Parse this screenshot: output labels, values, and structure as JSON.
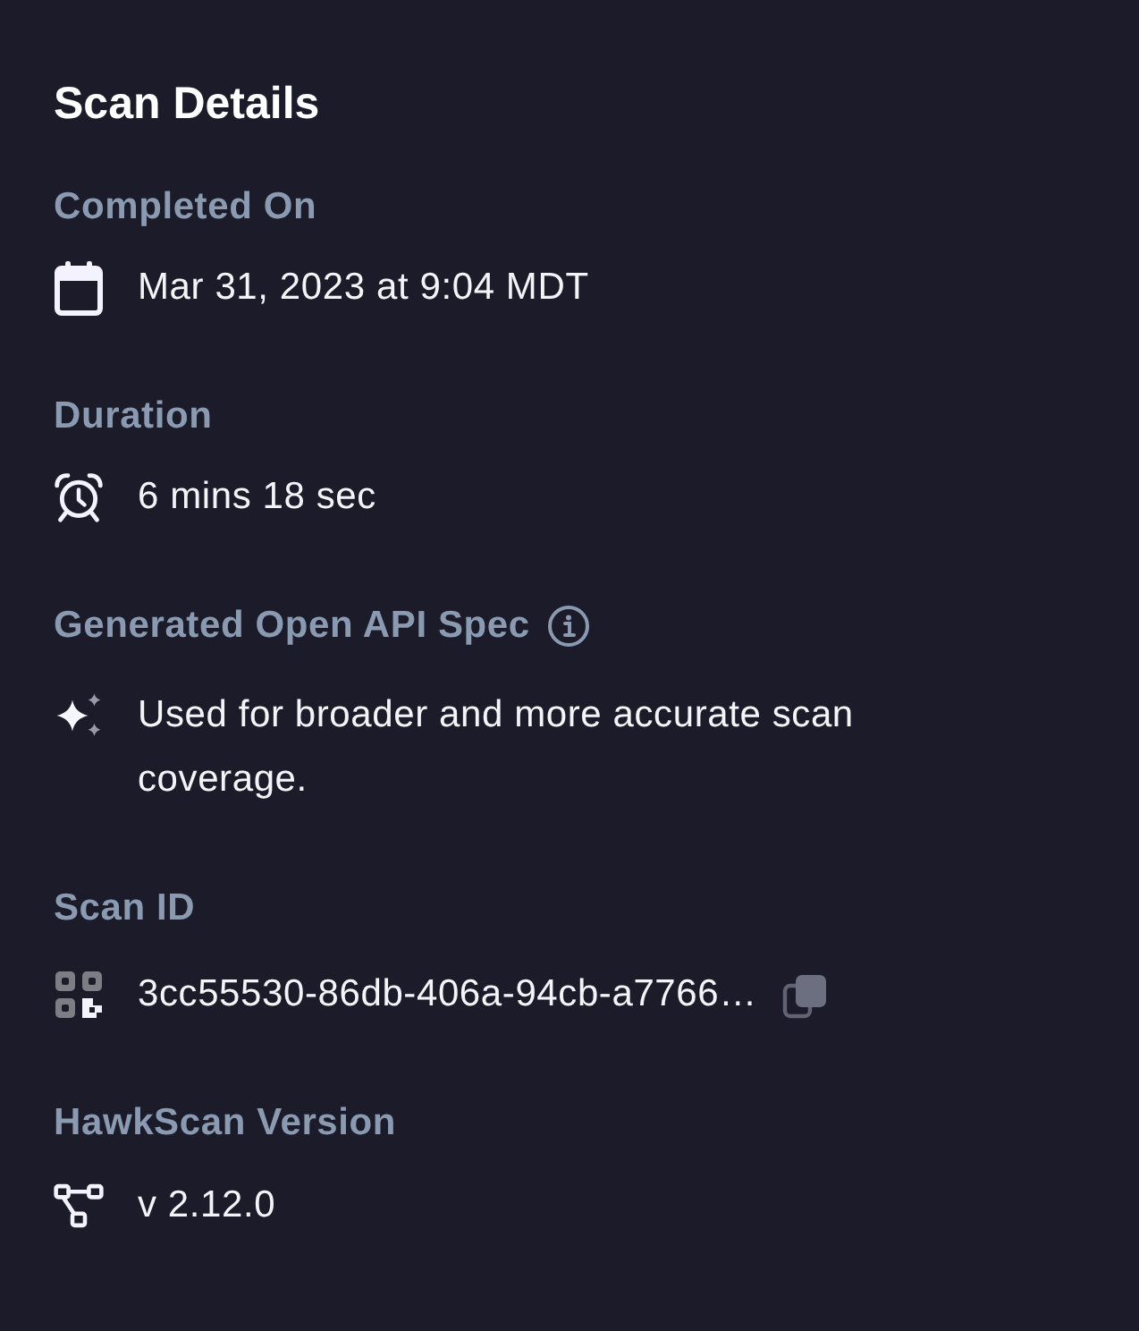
{
  "title": "Scan Details",
  "sections": [
    {
      "kind": "date",
      "label": "Completed On",
      "value": "Mar 31, 2023 at 9:04 MDT"
    },
    {
      "kind": "duration",
      "label": "Duration",
      "value": "6 mins 18 sec"
    },
    {
      "kind": "spec",
      "label": "Generated Open API Spec",
      "info": true,
      "value": "Used for broader and more accurate scan coverage."
    },
    {
      "kind": "id",
      "label": "Scan ID",
      "value": "3cc55530-86db-406a-94cb-a7766…",
      "copyable": true
    },
    {
      "kind": "version",
      "label": "HawkScan Version",
      "value": "v 2.12.0"
    }
  ]
}
